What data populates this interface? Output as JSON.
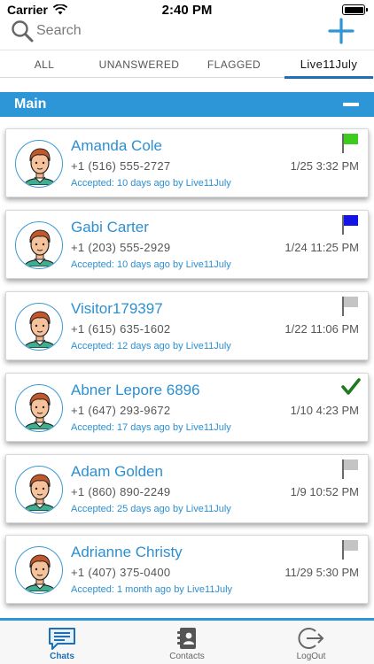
{
  "status_bar": {
    "carrier": "Carrier",
    "time": "2:40 PM"
  },
  "search": {
    "placeholder": "Search",
    "value": ""
  },
  "tabs": [
    {
      "label": "ALL",
      "active": false
    },
    {
      "label": "UNANSWERED",
      "active": false
    },
    {
      "label": "FLAGGED",
      "active": false
    },
    {
      "label": "Live11July",
      "active": true
    }
  ],
  "section": {
    "title": "Main",
    "color": "#2d96d6"
  },
  "chats": [
    {
      "name": "Amanda Cole",
      "phone": "+1 (516) 555-2727",
      "accepted": "Accepted: 10 days ago by Live11July",
      "date": "1/25 3:32 PM",
      "flag": "flag-icon",
      "flag_color": "#3dcc1e"
    },
    {
      "name": "Gabi Carter",
      "phone": "+1 (203) 555-2929",
      "accepted": "Accepted: 10 days ago by Live11July",
      "date": "1/24 11:25 PM",
      "flag": "flag-icon",
      "flag_color": "#1414e6"
    },
    {
      "name": "Visitor179397",
      "phone": "+1 (615) 635-1602",
      "accepted": "Accepted: 12 days ago by Live11July",
      "date": "1/22 11:06 PM",
      "flag": "flag-icon",
      "flag_color": "#c4c4c4"
    },
    {
      "name": "Abner Lepore 6896",
      "phone": "+1 (647) 293-9672",
      "accepted": "Accepted: 17 days ago by Live11July",
      "date": "1/10 4:23 PM",
      "flag": "checkmark-icon",
      "flag_color": "#1f7a1f"
    },
    {
      "name": "Adam Golden",
      "phone": "+1 (860) 890-2249",
      "accepted": "Accepted: 25 days ago by Live11July",
      "date": "1/9 10:52 PM",
      "flag": "flag-icon",
      "flag_color": "#c4c4c4"
    },
    {
      "name": "Adrianne Christy",
      "phone": "+1 (407) 375-0400",
      "accepted": "Accepted: 1 month ago by Live11July",
      "date": "11/29 5:30 PM",
      "flag": "flag-icon",
      "flag_color": "#c4c4c4"
    }
  ],
  "tabbar": [
    {
      "label": "Chats",
      "icon": "chat-icon",
      "active": true
    },
    {
      "label": "Contacts",
      "icon": "contacts-icon",
      "active": false
    },
    {
      "label": "LogOut",
      "icon": "logout-icon",
      "active": false
    }
  ],
  "colors": {
    "accent": "#2d96d6",
    "name_text": "#2d8fd0",
    "tab_underline": "#1f6fb5"
  }
}
